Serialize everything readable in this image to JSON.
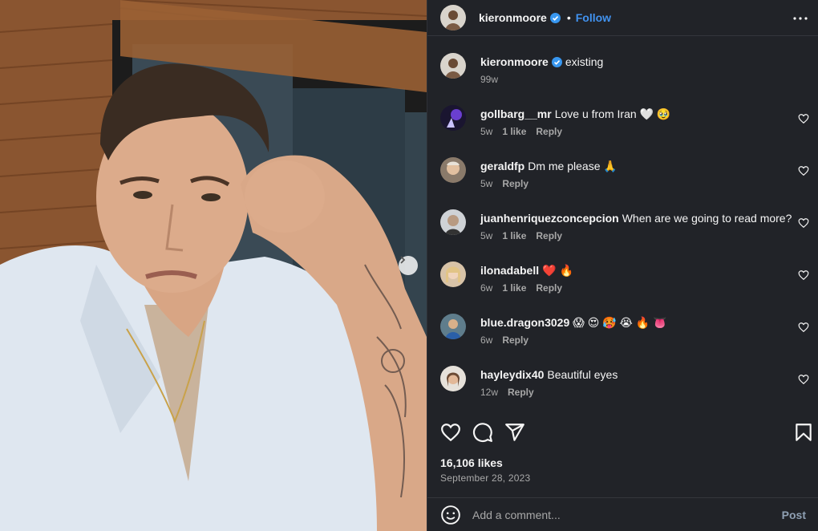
{
  "post": {
    "username": "kieronmoore",
    "follow_label": "Follow",
    "dot": "•",
    "caption": "existing",
    "caption_time": "99w",
    "likes": "16,106 likes",
    "date": "September 28, 2023"
  },
  "comments": [
    {
      "user": "gollbarg__mr",
      "text": "Love u from Iran 🤍 🥹",
      "time": "5w",
      "likes": "1 like",
      "reply": "Reply"
    },
    {
      "user": "geraldfp",
      "text": "Dm me please 🙏",
      "time": "5w",
      "likes": "",
      "reply": "Reply"
    },
    {
      "user": "juanhenriquezconcepcion",
      "text": "When are we going to read more?",
      "time": "5w",
      "likes": "1 like",
      "reply": "Reply"
    },
    {
      "user": "ilonadabell",
      "text": "❤️ 🔥",
      "time": "6w",
      "likes": "1 like",
      "reply": "Reply"
    },
    {
      "user": "blue.dragon3029",
      "text": "😱 😍 🥵 😭 🔥 👅",
      "time": "6w",
      "likes": "",
      "reply": "Reply"
    },
    {
      "user": "hayleydix40",
      "text": "Beautiful eyes",
      "time": "12w",
      "likes": "",
      "reply": "Reply"
    }
  ],
  "add_comment": {
    "placeholder": "Add a comment...",
    "post_label": "Post"
  },
  "icons": {
    "verified": "verified-badge-icon",
    "more": "more-options-icon",
    "like": "heart-icon",
    "comment": "comment-icon",
    "share": "share-icon",
    "save": "bookmark-icon",
    "emoji": "emoji-icon",
    "next": "chevron-right-icon"
  },
  "colors": {
    "accent": "#4192ef",
    "panel_bg": "#212328",
    "muted": "#a8a8a8"
  }
}
